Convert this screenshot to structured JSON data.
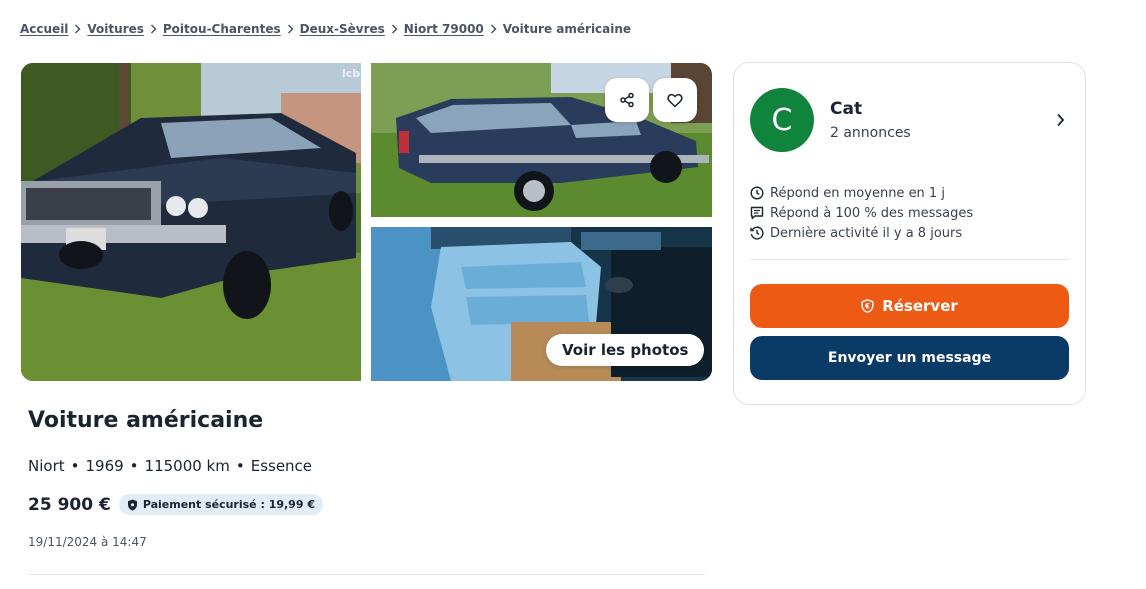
{
  "breadcrumb": {
    "items": [
      "Accueil",
      "Voitures",
      "Poitou-Charentes",
      "Deux-Sèvres",
      "Niort 79000"
    ],
    "current": "Voiture américaine"
  },
  "gallery": {
    "see_photos_label": "Voir les photos",
    "share_icon": "share-icon",
    "favorite_icon": "heart-icon",
    "watermark": "lcb"
  },
  "ad": {
    "title": "Voiture américaine",
    "location": "Niort",
    "year": "1969",
    "mileage": "115000 km",
    "fuel": "Essence",
    "price": "25 900 €",
    "payment_badge": "Paiement sécurisé : 19,99 €",
    "date": "19/11/2024 à 14:47"
  },
  "seller": {
    "avatar_letter": "C",
    "avatar_color": "#10833d",
    "name": "Cat",
    "ads_count": "2 annonces",
    "stats": [
      "Répond en moyenne en 1 j",
      "Répond à 100 % des messages",
      "Dernière activité il y a 8 jours"
    ],
    "reserve_label": "Réserver",
    "message_label": "Envoyer un message"
  },
  "colors": {
    "reserve": "#ec5a13",
    "message": "#0a3b66",
    "badge_bg": "#e2ecf8"
  }
}
